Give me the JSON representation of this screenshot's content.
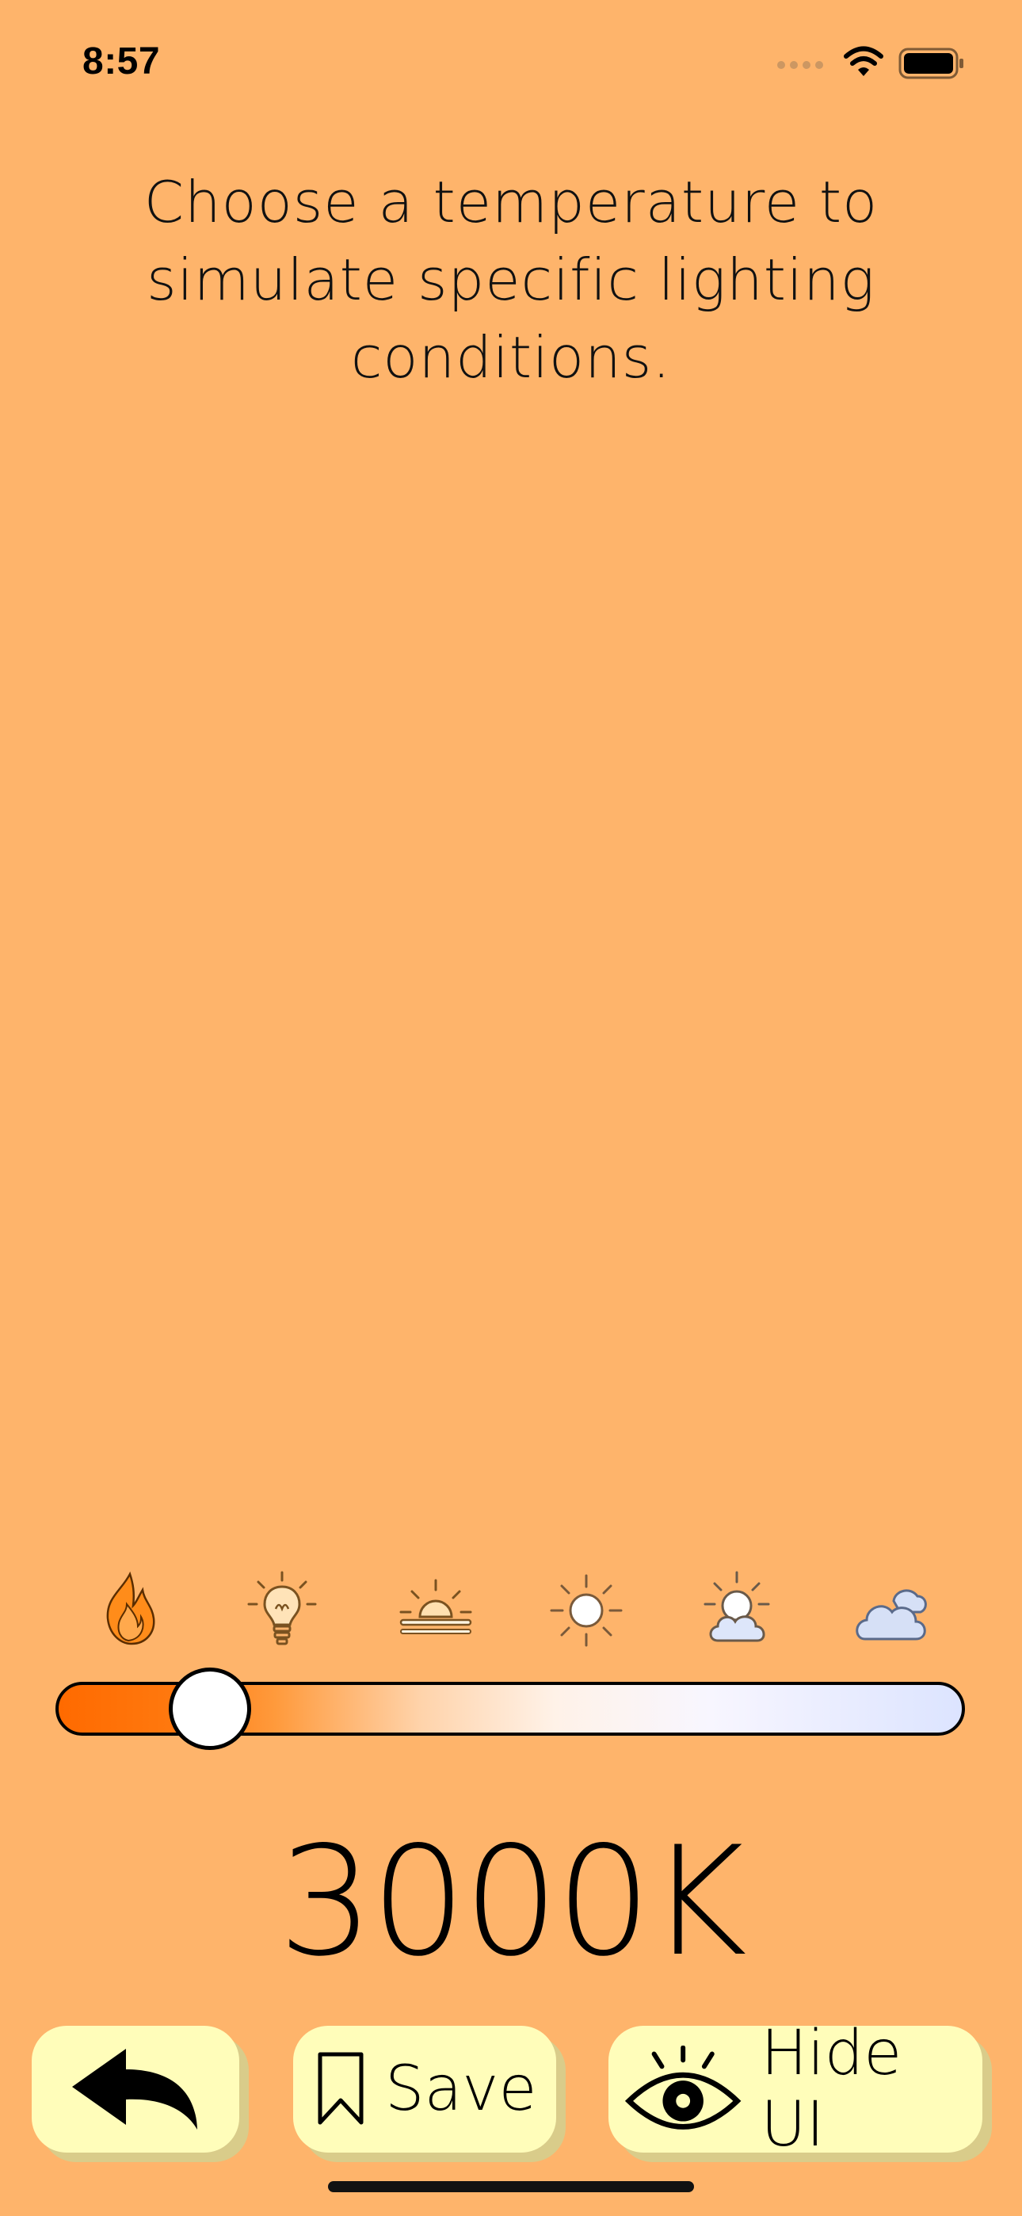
{
  "status_bar": {
    "time": "8:57",
    "icons": [
      "signal-dots-icon",
      "wifi-icon",
      "battery-icon"
    ]
  },
  "instructions": "Choose a temperature to simulate specific lighting conditions.",
  "presets": [
    {
      "icon": "flame-icon"
    },
    {
      "icon": "light-bulb-icon"
    },
    {
      "icon": "sunrise-icon"
    },
    {
      "icon": "sun-icon"
    },
    {
      "icon": "partly-sunny-icon"
    },
    {
      "icon": "cloudy-icon"
    }
  ],
  "slider": {
    "value_fraction": 0.17,
    "gradient_colors": [
      "#FF6A00",
      "#FF9A3C",
      "#FFD3AA",
      "#FFF2E8",
      "#F8F6FF",
      "#DCE4FF"
    ]
  },
  "temperature_label": "3000K",
  "buttons": {
    "back": {
      "icon": "back-arrow-icon"
    },
    "save": {
      "label": "Save",
      "icon": "bookmark-icon"
    },
    "hide": {
      "label": "Hide UI",
      "icon": "eye-icon"
    }
  },
  "colors": {
    "background": "#FEB46B",
    "button_fill": "#FFFDBA",
    "button_shadow": "#D9CC8A"
  }
}
